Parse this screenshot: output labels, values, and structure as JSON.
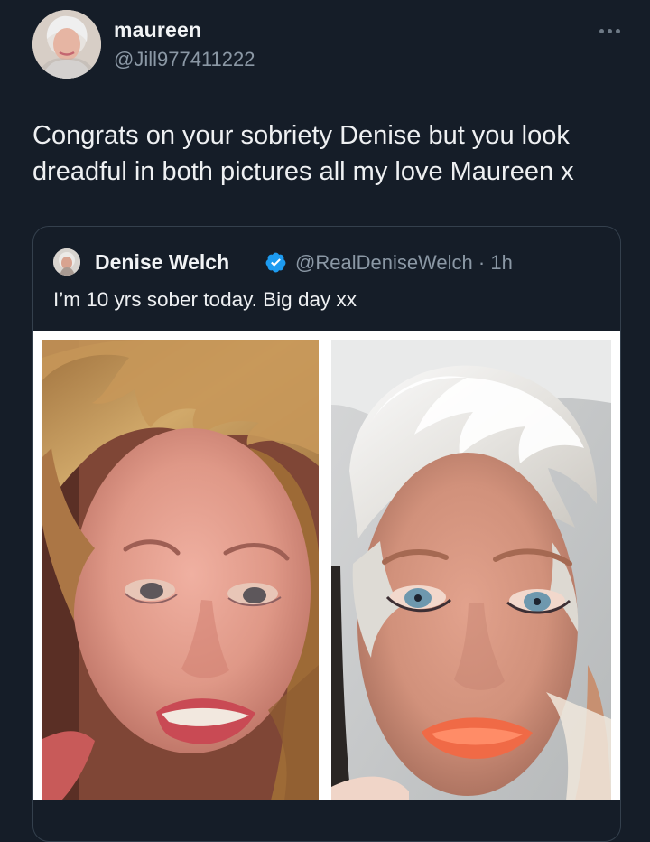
{
  "tweet": {
    "author_name": "maureen",
    "author_handle": "@Jill977411222",
    "text": "Congrats on your sobriety Denise but you look dreadful in both pictures all my love Maureen x"
  },
  "quote": {
    "author_name": "Denise Welch",
    "handle_and_time": "@RealDeniseWelch · 1h",
    "text": "I’m 10 yrs sober today. Big day xx"
  },
  "icons": {
    "more": "more-horizontal-icon",
    "verified": "verified-badge-icon"
  },
  "colors": {
    "background": "#151d28",
    "text": "#eef0f2",
    "muted": "#8b98a5",
    "verified": "#1d9bf0",
    "border": "#34404d"
  }
}
